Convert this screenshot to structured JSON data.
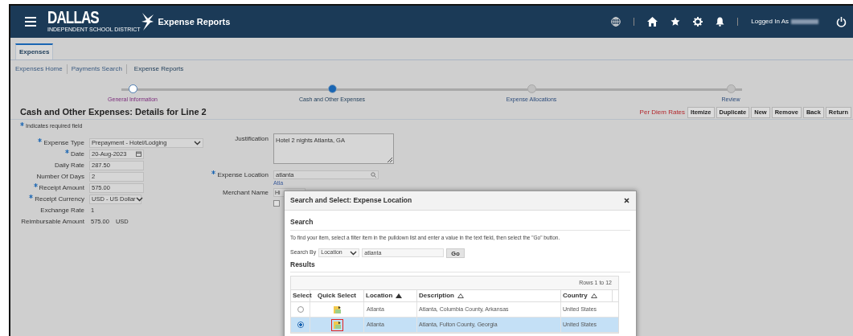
{
  "header": {
    "title": "Expense Reports",
    "logo": {
      "name": "DALLAS",
      "subtitle": "INDEPENDENT SCHOOL DISTRICT"
    },
    "user_label": "Logged In As"
  },
  "tabs": [
    {
      "label": "Expenses",
      "selected": true
    }
  ],
  "subnav": [
    {
      "label": "Expenses Home",
      "selected": false
    },
    {
      "label": "Payments Search",
      "selected": false
    },
    {
      "label": "Expense Reports",
      "selected": true
    }
  ],
  "train": [
    {
      "label": "General Information",
      "visited": true,
      "current": false
    },
    {
      "label": "Cash and Other Expenses",
      "visited": false,
      "current": true
    },
    {
      "label": "Expense Allocations",
      "visited": false,
      "current": false
    },
    {
      "label": "Review",
      "visited": false,
      "current": false
    }
  ],
  "page_title": "Cash and Other Expenses: Details for Line 2",
  "actions": {
    "link": "Per Diem Rates",
    "buttons": [
      "Itemize",
      "Duplicate",
      "New",
      "Remove",
      "Back",
      "Return"
    ]
  },
  "required_note": "Indicates required field",
  "left_fields": [
    {
      "label": "Expense Type",
      "required": true,
      "kind": "select",
      "value": "Prepayment - Hotel/Lodging"
    },
    {
      "label": "Date",
      "required": true,
      "kind": "date",
      "value": "20-Aug-2023"
    },
    {
      "label": "Daily Rate",
      "required": false,
      "kind": "input",
      "value": "287.50"
    },
    {
      "label": "Number Of Days",
      "required": false,
      "kind": "input",
      "value": "2"
    },
    {
      "label": "Receipt Amount",
      "required": true,
      "kind": "input",
      "value": "575.00"
    },
    {
      "label": "Receipt Currency",
      "required": true,
      "kind": "smallselect",
      "value": "USD - US Dollar"
    },
    {
      "label": "Exchange Rate",
      "required": false,
      "kind": "text",
      "value": "1"
    },
    {
      "label": "Reimbursable Amount",
      "required": false,
      "kind": "text",
      "value": "575.00",
      "unit": "USD"
    }
  ],
  "right_fields": {
    "justification": {
      "label": "Justification",
      "value": "Hotel 2 nights Atlanta, GA"
    },
    "expense_location": {
      "label": "Expense Location",
      "required": true,
      "value": "atlanta",
      "link": "Atla"
    },
    "merchant_name": {
      "label": "Merchant Name",
      "value": "Hi"
    },
    "checkbox": {
      "checked": false
    }
  },
  "dialog": {
    "title": "Search and Select: Expense Location",
    "search_heading": "Search",
    "instruction": "To find your item, select a filter item in the pulldown list and enter a value in the text field, then select the \"Go\" button.",
    "search_by_label": "Search By",
    "search_by": "Location",
    "search_value": "atlanta",
    "go": "Go",
    "results_heading": "Results",
    "rows_label": "Rows 1 to 12",
    "columns": [
      {
        "label": "Select"
      },
      {
        "label": "Quick Select"
      },
      {
        "label": "Location",
        "sorted": true
      },
      {
        "label": "Description",
        "sorted": false
      },
      {
        "label": "Country",
        "sorted": false
      }
    ],
    "rows": [
      {
        "selected": false,
        "highlighted": false,
        "location": "Atlanta",
        "description": "Atlanta, Columbia County, Arkansas",
        "country": "United States"
      },
      {
        "selected": true,
        "highlighted": true,
        "location": "Atlanta",
        "description": "Atlanta, Fulton County, Georgia",
        "country": "United States"
      }
    ]
  }
}
